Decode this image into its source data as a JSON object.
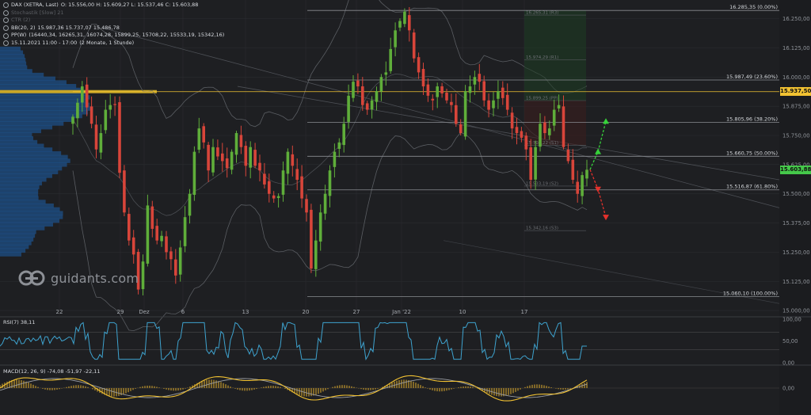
{
  "legend": {
    "instrument": "DAX (XETRA, Last)",
    "ohlc": "O: 15.556,00  H: 15.609,27  L: 15.537,46  C: 15.603,88",
    "line2": "Stochastik [Slow] 21",
    "line3": "CTR (2)",
    "bb_label": "BB(20, 2)",
    "bb_values": "15.987,36  15.737,07  15.486,78",
    "pp_label": "PP(W)",
    "pp_values": "(16440,34, 16265,31, 16074,28, 15899,25, 15708,22, 15533,19, 15342,16)",
    "time_label": "15.11.2021 11:00 - 17:00",
    "time_range": "(2 Monate, 1 Stunde)"
  },
  "logo": {
    "text": "guidants.com"
  },
  "rsi_label": "RSI(7)  38,11",
  "macd_label": "MACD(12, 26, 9)  -74,08  -51,97  -22,11",
  "colors": {
    "background": "#1e1f22",
    "up": "#5fae3a",
    "down": "#d8453a",
    "fib": "#8a8d92",
    "price_tag": "#f2c232",
    "current_tag": "#45c84a",
    "rsi": "#3ea3cf",
    "macd": "#f2c232"
  },
  "chart_data": {
    "type": "candlestick",
    "ylim": [
      14980,
      16330
    ],
    "y_ticks": [
      "16.250,00",
      "16.125,00",
      "16.000,00",
      "15.875,00",
      "15.750,00",
      "15.625,00",
      "15.500,00",
      "15.375,00",
      "15.250,00",
      "15.125,00",
      "15.000,00"
    ],
    "y_tick_values": [
      16250,
      16125,
      16000,
      15875,
      15750,
      15625,
      15500,
      15375,
      15250,
      15125,
      15000
    ],
    "x_ticks": [
      "22",
      "29",
      "Dez",
      "6",
      "13",
      "20",
      "27",
      "Jan '22",
      "10",
      "17"
    ],
    "fib_levels": [
      {
        "label": "16.285,35 (0.00%)",
        "value": 16285.35
      },
      {
        "label": "15.987,49 (23.60%)",
        "value": 15987.49
      },
      {
        "label": "15.805,96 (38.20%)",
        "value": 15805.96
      },
      {
        "label": "15.660,75 (50.00%)",
        "value": 15660.75
      },
      {
        "label": "15.516,87 (61.80%)",
        "value": 15516.87
      },
      {
        "label": "15.060,10 (100.00%)",
        "value": 15060.1
      }
    ],
    "pivot_labels": [
      {
        "label": "16.265,31 (R3)",
        "value": 16265.31
      },
      {
        "label": "15.974,29 (R1)",
        "value": 16074.28
      },
      {
        "label": "15.899,25 (PP)",
        "value": 15899.25
      },
      {
        "label": "15.708,22 (S1)",
        "value": 15708.22
      },
      {
        "label": "15.533,19 (S2)",
        "value": 15533.19
      },
      {
        "label": "15.342,16 (S3)",
        "value": 15342.16
      }
    ],
    "price_labels": [
      {
        "label": "15.937,50",
        "value": 15937.5,
        "kind": "price"
      },
      {
        "label": "15.603,88",
        "value": 15603.88,
        "kind": "current"
      }
    ],
    "close_path": [
      15830,
      15890,
      15960,
      15870,
      15800,
      15690,
      15760,
      15860,
      15880,
      15880,
      15590,
      15420,
      15300,
      15240,
      15090,
      15210,
      15450,
      15350,
      15300,
      15320,
      15250,
      15220,
      15150,
      15270,
      15400,
      15500,
      15680,
      15780,
      15720,
      15600,
      15700,
      15660,
      15640,
      15610,
      15680,
      15760,
      15700,
      15620,
      15700,
      15620,
      15600,
      15540,
      15500,
      15480,
      15490,
      15600,
      15680,
      15620,
      15560,
      15480,
      15420,
      15180,
      15300,
      15420,
      15500,
      15600,
      15680,
      15720,
      15800,
      15920,
      15980,
      15960,
      15880,
      15860,
      15900,
      15940,
      16000,
      16020,
      16120,
      16200,
      16240,
      16280,
      16200,
      16080,
      16020,
      15960,
      15920,
      15900,
      15960,
      15930,
      15900,
      15880,
      15800,
      15760,
      15940,
      15960,
      16000,
      15980,
      15900,
      15860,
      15900,
      15940,
      15910,
      15860,
      15780,
      15760,
      15740,
      15690,
      15560,
      15700,
      15800,
      15760,
      15780,
      15860,
      15880,
      15700,
      15640,
      15560,
      15500,
      15580,
      15603
    ],
    "projection": {
      "bull": [
        15603.88,
        15680,
        15810
      ],
      "bear": [
        15603.88,
        15520,
        15400
      ]
    },
    "rsi": {
      "ylim": [
        0,
        100
      ],
      "ticks": [
        "100,00",
        "50,00",
        "0,00"
      ],
      "tick_values": [
        100,
        50,
        0
      ],
      "overbought": 70,
      "oversold": 30,
      "last": 38.11
    },
    "macd": {
      "ticks": [
        "0,00"
      ],
      "macd": -74.08,
      "signal": -51.97,
      "histogram": -22.11
    }
  }
}
